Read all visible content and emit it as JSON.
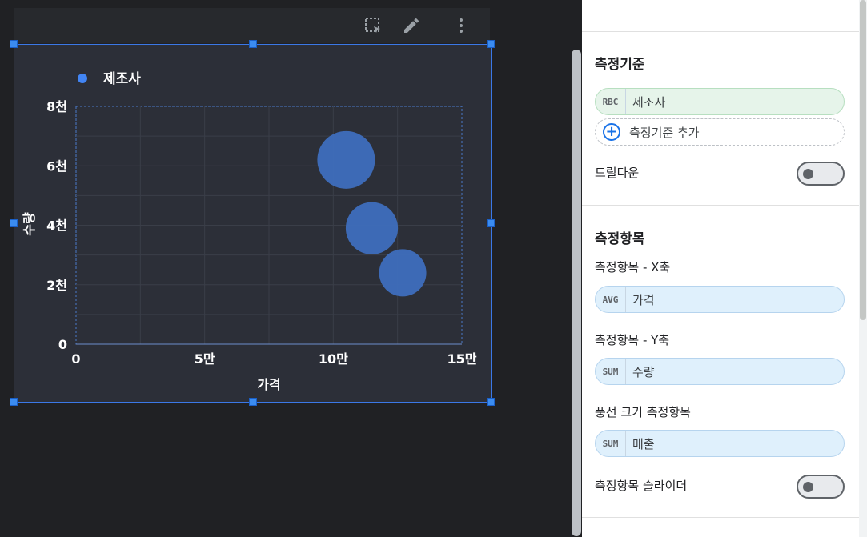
{
  "chart_data": {
    "type": "scatter",
    "legend": {
      "label": "제조사",
      "color": "#4285f4",
      "placement": "top-left"
    },
    "xlabel": "가격",
    "ylabel": "수량",
    "xlim": [
      0,
      150000
    ],
    "ylim": [
      0,
      8000
    ],
    "x_ticks": [
      {
        "value": 0,
        "label": "0"
      },
      {
        "value": 50000,
        "label": "5만"
      },
      {
        "value": 100000,
        "label": "10만"
      },
      {
        "value": 150000,
        "label": "15만"
      }
    ],
    "y_ticks": [
      {
        "value": 0,
        "label": "0"
      },
      {
        "value": 2000,
        "label": "2천"
      },
      {
        "value": 4000,
        "label": "4천"
      },
      {
        "value": 6000,
        "label": "6천"
      },
      {
        "value": 8000,
        "label": "8천"
      }
    ],
    "bubble_color": "#3e6ebd",
    "points": [
      {
        "x": 105000,
        "y": 6200,
        "size": 1.0
      },
      {
        "x": 115000,
        "y": 3900,
        "size": 0.82
      },
      {
        "x": 127000,
        "y": 2400,
        "size": 0.67
      }
    ]
  },
  "toolbar": {
    "icons": [
      "select-area-icon",
      "pencil-icon",
      "more-vert-icon"
    ]
  },
  "panel": {
    "dimension_section": {
      "title": "측정기준",
      "chip": {
        "tag": "RBC",
        "name": "제조사"
      },
      "add_label": "측정기준 추가",
      "drilldown_label": "드릴다운",
      "drilldown_on": false
    },
    "metric_section": {
      "title": "측정항목",
      "x_label": "측정항목 - X축",
      "x_chip": {
        "tag": "AVG",
        "name": "가격"
      },
      "y_label": "측정항목 - Y축",
      "y_chip": {
        "tag": "SUM",
        "name": "수량"
      },
      "bubble_label": "풍선 크기 측정항목",
      "bubble_chip": {
        "tag": "SUM",
        "name": "매출"
      },
      "slider_label": "측정항목 슬라이더",
      "slider_on": false
    }
  }
}
